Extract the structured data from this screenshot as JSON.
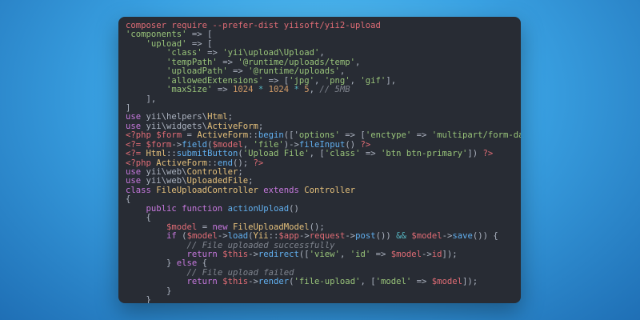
{
  "colors": {
    "background_gradient": [
      "#5cc6f5",
      "#3aa2e3",
      "#1f6fb5"
    ],
    "editor_bg": "#282c34",
    "plain": "#abb2bf",
    "command": "#e06c75",
    "string": "#98c379",
    "keyword": "#c678dd",
    "function": "#61afef",
    "variable": "#e06c75",
    "number": "#d19a66",
    "class": "#e5c07b",
    "comment": "#7f848e",
    "operator": "#56b6c2"
  },
  "code_lines": [
    [
      [
        "cmd",
        "composer require --prefer-dist yiisoft/yii2-upload"
      ]
    ],
    [
      [
        "str",
        "'components'"
      ],
      [
        "pun",
        " => ["
      ]
    ],
    [
      [
        "pun",
        "    "
      ],
      [
        "str",
        "'upload'"
      ],
      [
        "pun",
        " => ["
      ]
    ],
    [
      [
        "pun",
        "        "
      ],
      [
        "str",
        "'class'"
      ],
      [
        "pun",
        " => "
      ],
      [
        "str",
        "'yii\\upload\\Upload'"
      ],
      [
        "pun",
        ","
      ]
    ],
    [
      [
        "pun",
        "        "
      ],
      [
        "str",
        "'tempPath'"
      ],
      [
        "pun",
        " => "
      ],
      [
        "str",
        "'@runtime/uploads/temp'"
      ],
      [
        "pun",
        ","
      ]
    ],
    [
      [
        "pun",
        "        "
      ],
      [
        "str",
        "'uploadPath'"
      ],
      [
        "pun",
        " => "
      ],
      [
        "str",
        "'@runtime/uploads'"
      ],
      [
        "pun",
        ","
      ]
    ],
    [
      [
        "pun",
        "        "
      ],
      [
        "str",
        "'allowedExtensions'"
      ],
      [
        "pun",
        " => ["
      ],
      [
        "str",
        "'jpg'"
      ],
      [
        "pun",
        ", "
      ],
      [
        "str",
        "'png'"
      ],
      [
        "pun",
        ", "
      ],
      [
        "str",
        "'gif'"
      ],
      [
        "pun",
        "],"
      ]
    ],
    [
      [
        "pun",
        "        "
      ],
      [
        "str",
        "'maxSize'"
      ],
      [
        "pun",
        " => "
      ],
      [
        "num",
        "1024"
      ],
      [
        "op",
        " * "
      ],
      [
        "num",
        "1024"
      ],
      [
        "op",
        " * "
      ],
      [
        "num",
        "5"
      ],
      [
        "pun",
        ", "
      ],
      [
        "com",
        "// 5MB"
      ]
    ],
    [
      [
        "pun",
        "    ],"
      ]
    ],
    [
      [
        "pun",
        "]"
      ]
    ],
    [
      [
        "kw",
        "use "
      ],
      [
        "pun",
        "yii\\helpers\\"
      ],
      [
        "cls",
        "Html"
      ],
      [
        "pun",
        ";"
      ]
    ],
    [
      [
        "kw",
        "use "
      ],
      [
        "pun",
        "yii\\widgets\\"
      ],
      [
        "cls",
        "ActiveForm"
      ],
      [
        "pun",
        ";"
      ]
    ],
    [
      [
        "php",
        "<?php "
      ],
      [
        "var",
        "$form"
      ],
      [
        "pun",
        " = "
      ],
      [
        "cls",
        "ActiveForm"
      ],
      [
        "pun",
        "::"
      ],
      [
        "fn",
        "begin"
      ],
      [
        "pun",
        "(['"
      ],
      [
        "str",
        "options'"
      ],
      [
        "pun",
        " => ["
      ],
      [
        "str",
        "'enctype'"
      ],
      [
        "pun",
        " => "
      ],
      [
        "str",
        "'multipart/form-data'"
      ],
      [
        "pun",
        "]]); "
      ],
      [
        "php",
        "?>"
      ]
    ],
    [
      [
        "php",
        "<?= "
      ],
      [
        "var",
        "$form"
      ],
      [
        "pun",
        "->"
      ],
      [
        "fn",
        "field"
      ],
      [
        "pun",
        "("
      ],
      [
        "var",
        "$model"
      ],
      [
        "pun",
        ", "
      ],
      [
        "str",
        "'file'"
      ],
      [
        "pun",
        ")->"
      ],
      [
        "fn",
        "fileInput"
      ],
      [
        "pun",
        "() "
      ],
      [
        "php",
        "?>"
      ]
    ],
    [
      [
        "php",
        "<?= "
      ],
      [
        "cls",
        "Html"
      ],
      [
        "pun",
        "::"
      ],
      [
        "fn",
        "submitButton"
      ],
      [
        "pun",
        "("
      ],
      [
        "str",
        "'Upload File'"
      ],
      [
        "pun",
        ", ["
      ],
      [
        "str",
        "'class'"
      ],
      [
        "pun",
        " => "
      ],
      [
        "str",
        "'btn btn-primary'"
      ],
      [
        "pun",
        "]) "
      ],
      [
        "php",
        "?>"
      ]
    ],
    [
      [
        "php",
        "<?php "
      ],
      [
        "cls",
        "ActiveForm"
      ],
      [
        "pun",
        "::"
      ],
      [
        "fn",
        "end"
      ],
      [
        "pun",
        "(); "
      ],
      [
        "php",
        "?>"
      ]
    ],
    [
      [
        "kw",
        "use "
      ],
      [
        "pun",
        "yii\\web\\"
      ],
      [
        "cls",
        "Controller"
      ],
      [
        "pun",
        ";"
      ]
    ],
    [
      [
        "kw",
        "use "
      ],
      [
        "pun",
        "yii\\web\\"
      ],
      [
        "cls",
        "UploadedFile"
      ],
      [
        "pun",
        ";"
      ]
    ],
    [
      [
        "kw",
        "class "
      ],
      [
        "cls",
        "FileUploadController"
      ],
      [
        "kw",
        " extends "
      ],
      [
        "cls",
        "Controller"
      ]
    ],
    [
      [
        "pun",
        "{"
      ]
    ],
    [
      [
        "pun",
        "    "
      ],
      [
        "kw",
        "public function "
      ],
      [
        "fn",
        "actionUpload"
      ],
      [
        "pun",
        "()"
      ]
    ],
    [
      [
        "pun",
        "    {"
      ]
    ],
    [
      [
        "pun",
        "        "
      ],
      [
        "var",
        "$model"
      ],
      [
        "pun",
        " = "
      ],
      [
        "kw",
        "new "
      ],
      [
        "cls",
        "FileUploadModel"
      ],
      [
        "pun",
        "();"
      ]
    ],
    [
      [
        "pun",
        "        "
      ],
      [
        "kw",
        "if"
      ],
      [
        "pun",
        " ("
      ],
      [
        "var",
        "$model"
      ],
      [
        "pun",
        "->"
      ],
      [
        "fn",
        "load"
      ],
      [
        "pun",
        "("
      ],
      [
        "cls",
        "Yii"
      ],
      [
        "pun",
        "::"
      ],
      [
        "var",
        "$app"
      ],
      [
        "pun",
        "->"
      ],
      [
        "var",
        "request"
      ],
      [
        "pun",
        "->"
      ],
      [
        "fn",
        "post"
      ],
      [
        "pun",
        "()) "
      ],
      [
        "op",
        "&&"
      ],
      [
        "pun",
        " "
      ],
      [
        "var",
        "$model"
      ],
      [
        "pun",
        "->"
      ],
      [
        "fn",
        "save"
      ],
      [
        "pun",
        "()) {"
      ]
    ],
    [
      [
        "pun",
        "            "
      ],
      [
        "com",
        "// File uploaded successfully"
      ]
    ],
    [
      [
        "pun",
        "            "
      ],
      [
        "kw",
        "return "
      ],
      [
        "var",
        "$this"
      ],
      [
        "pun",
        "->"
      ],
      [
        "fn",
        "redirect"
      ],
      [
        "pun",
        "(["
      ],
      [
        "str",
        "'view'"
      ],
      [
        "pun",
        ", "
      ],
      [
        "str",
        "'id'"
      ],
      [
        "pun",
        " => "
      ],
      [
        "var",
        "$model"
      ],
      [
        "pun",
        "->"
      ],
      [
        "var",
        "id"
      ],
      [
        "pun",
        "]);"
      ]
    ],
    [
      [
        "pun",
        "        } "
      ],
      [
        "kw",
        "else"
      ],
      [
        "pun",
        " {"
      ]
    ],
    [
      [
        "pun",
        "            "
      ],
      [
        "com",
        "// File upload failed"
      ]
    ],
    [
      [
        "pun",
        "            "
      ],
      [
        "kw",
        "return "
      ],
      [
        "var",
        "$this"
      ],
      [
        "pun",
        "->"
      ],
      [
        "fn",
        "render"
      ],
      [
        "pun",
        "("
      ],
      [
        "str",
        "'file-upload'"
      ],
      [
        "pun",
        ", ["
      ],
      [
        "str",
        "'model'"
      ],
      [
        "pun",
        " => "
      ],
      [
        "var",
        "$model"
      ],
      [
        "pun",
        "]);"
      ]
    ],
    [
      [
        "pun",
        "        }"
      ]
    ],
    [
      [
        "pun",
        "    }"
      ]
    ],
    [
      [
        "pun",
        "}"
      ]
    ]
  ]
}
